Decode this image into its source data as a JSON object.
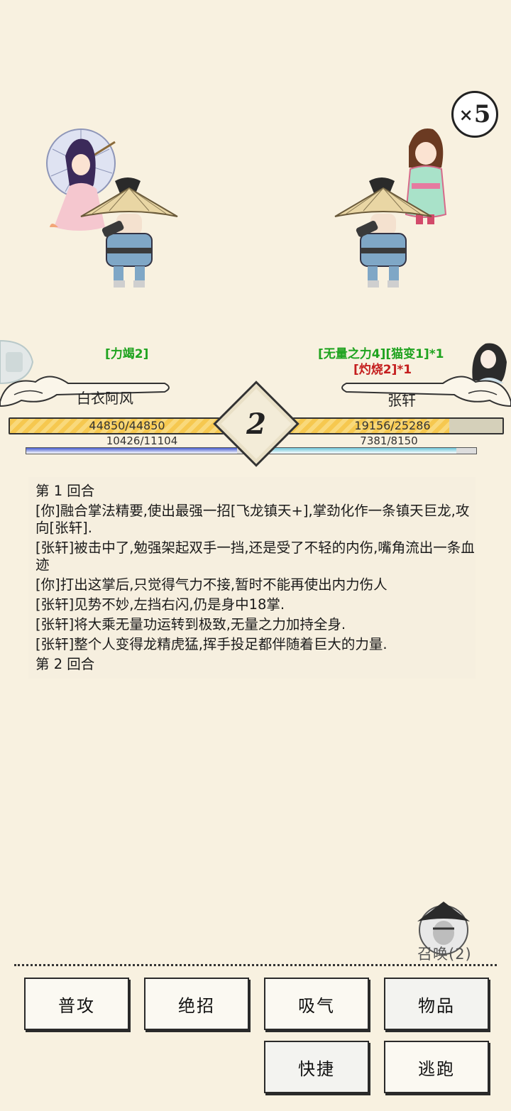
{
  "battle": {
    "speed": "5",
    "speed_prefix": "×",
    "round": "2"
  },
  "player": {
    "name": "白衣阿风",
    "status": "[力竭2]",
    "hp": "44850/44850",
    "hp_fraction": 1.0,
    "mp": "10426/11104",
    "mp_fraction": 0.939,
    "colors": {
      "hp": "#f6c84f",
      "mp": "#4a5fcf"
    }
  },
  "enemy": {
    "name": "张轩",
    "status_green": "[无量之力4][猫变1]*1",
    "status_red": "[灼烧2]*1",
    "hp": "19156/25286",
    "hp_fraction": 0.757,
    "mp": "7381/8150",
    "mp_fraction": 0.906,
    "colors": {
      "hp": "#f6c84f",
      "mp": "#6fc7d9"
    }
  },
  "log": [
    "第 1 回合",
    "[你]融合掌法精要,使出最强一招[飞龙镇天+],掌劲化作一条镇天巨龙,攻向[张轩].",
    "[张轩]被击中了,勉强架起双手一挡,还是受了不轻的内伤,嘴角流出一条血迹",
    "[你]打出这掌后,只觉得气力不接,暂时不能再使出内力伤人",
    "[张轩]见势不妙,左挡右闪,仍是身中18掌.",
    "[张轩]将大乘无量功运转到极致,无量之力加持全身.",
    "[张轩]整个人变得龙精虎猛,挥手投足都伴随着巨大的力量.",
    "第 2 回合"
  ],
  "summon": {
    "label": "召唤(2)"
  },
  "actions": {
    "attack": "普攻",
    "ultimate": "绝招",
    "breathe": "吸气",
    "items": "物品",
    "quick": "快捷",
    "flee": "逃跑"
  }
}
